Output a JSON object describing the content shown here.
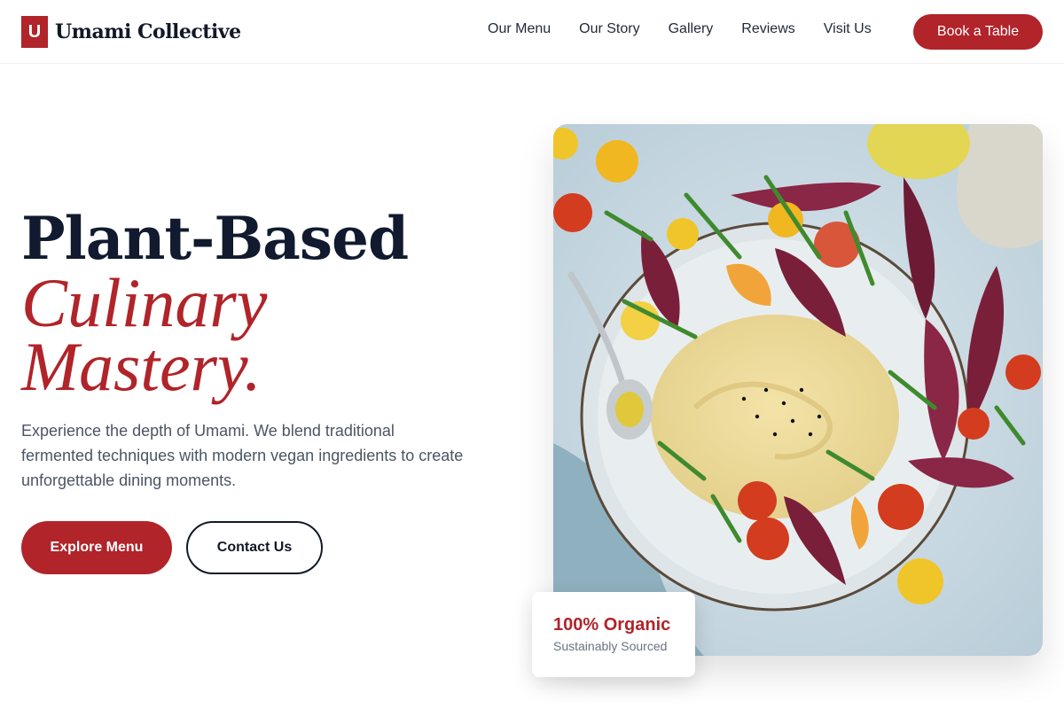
{
  "brand": {
    "mark": "U",
    "name": "Umami Collective"
  },
  "nav": {
    "links": [
      "Our Menu",
      "Our Story",
      "Gallery",
      "Reviews",
      "Visit Us"
    ],
    "cta": "Book a Table"
  },
  "hero": {
    "line1": "Plant-Based",
    "line2": "Culinary",
    "line3": "Mastery.",
    "lead": "Experience the depth of Umami. We blend traditional fermented techniques with modern vegan ingredients to create unforgettable dining moments.",
    "primary_cta": "Explore Menu",
    "secondary_cta": "Contact Us"
  },
  "badge": {
    "title": "100% Organic",
    "subtitle": "Sustainably Sourced"
  },
  "colors": {
    "accent": "#b0242a",
    "heading": "#111a2e",
    "body": "#4b5563"
  },
  "icons": {
    "brand": "brand-logo-icon"
  }
}
